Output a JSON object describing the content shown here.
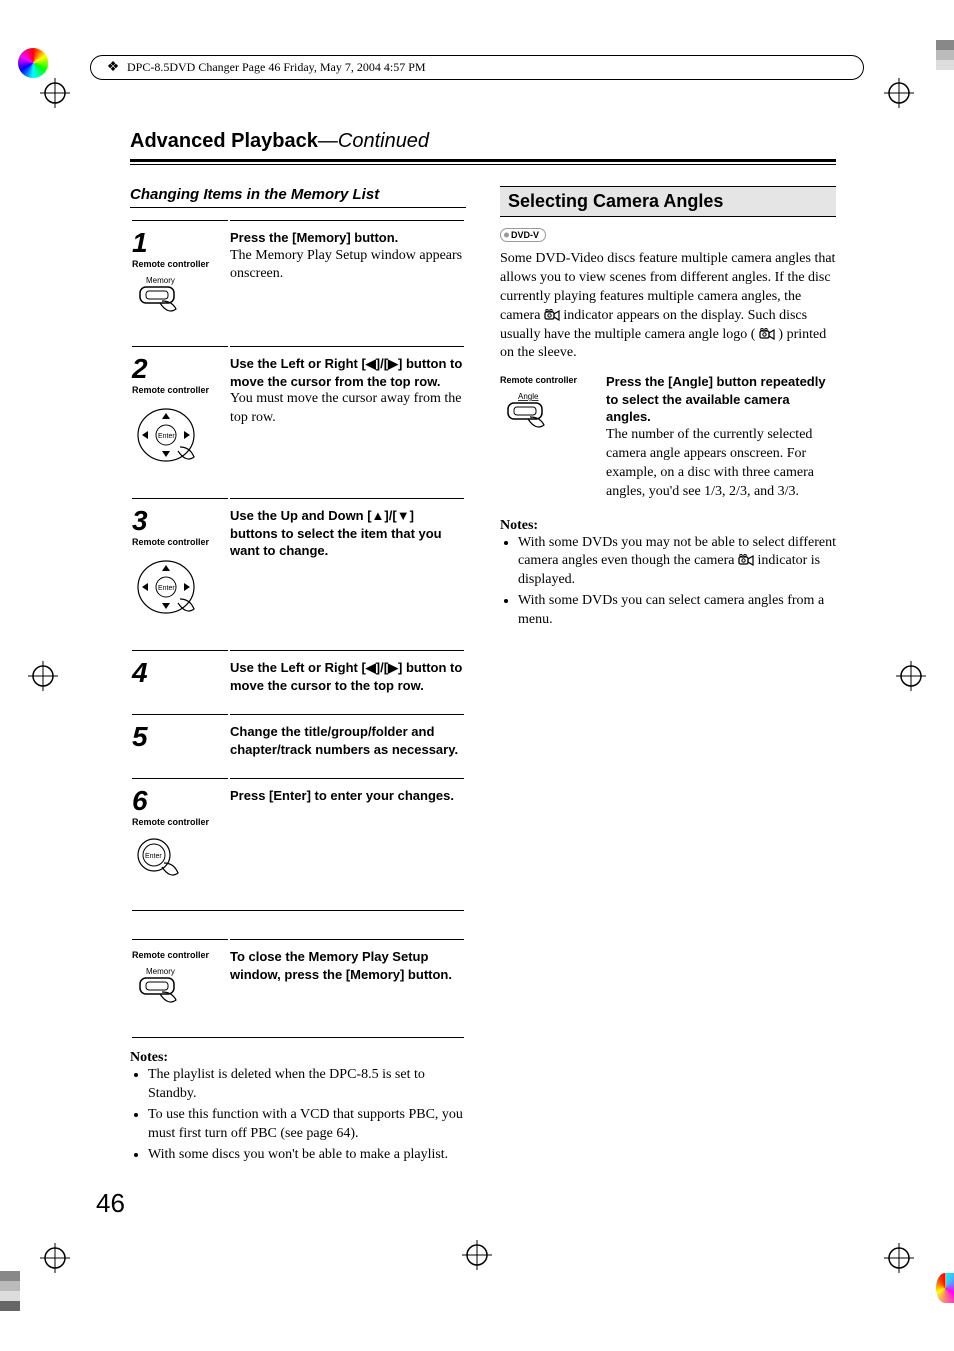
{
  "framemaker": {
    "text": "DPC-8.5DVD Changer  Page 46  Friday, May 7, 2004  4:57 PM"
  },
  "heading": {
    "main": "Advanced Playback",
    "cont": "—Continued"
  },
  "left": {
    "subheading": "Changing Items in the Memory List",
    "steps": [
      {
        "num": "1",
        "rc": "Remote controller",
        "btn_label": "Memory",
        "bold": "Press the [Memory] button.",
        "body": "The Memory Play Setup window appears onscreen."
      },
      {
        "num": "2",
        "rc": "Remote controller",
        "btn_label": "Enter",
        "bold": "Use the Left or Right [◀]/[▶] button to move the cursor from the top row.",
        "body": "You must move the cursor away from the top row."
      },
      {
        "num": "3",
        "rc": "Remote controller",
        "btn_label": "Enter",
        "bold": "Use the Up and Down [▲]/[▼] buttons to select the item that you want to change.",
        "body": ""
      },
      {
        "num": "4",
        "rc": "",
        "btn_label": "",
        "bold": "Use the Left or Right [◀]/[▶] button to move the cursor to the top row.",
        "body": ""
      },
      {
        "num": "5",
        "rc": "",
        "btn_label": "",
        "bold": "Change the title/group/folder and chapter/track numbers as necessary.",
        "body": ""
      },
      {
        "num": "6",
        "rc": "Remote controller",
        "btn_label": "Enter",
        "bold": "Press [Enter] to enter your changes.",
        "body": ""
      }
    ],
    "close": {
      "rc": "Remote controller",
      "btn_label": "Memory",
      "bold": "To close the Memory Play Setup window, press the [Memory] button."
    },
    "notes_label": "Notes:",
    "notes": [
      "The playlist is deleted when the DPC-8.5 is set to Standby.",
      "To use this function with a VCD that supports PBC, you must first turn off PBC (see page 64).",
      "With some discs you won't be able to make a playlist."
    ]
  },
  "right": {
    "section_title": "Selecting Camera Angles",
    "badge": "DVD-V",
    "para_parts": {
      "a": "Some DVD-Video discs feature multiple camera angles that allows you to view scenes from different angles. If the disc currently playing features multiple camera angles, the camera ",
      "b": " indicator appears on the display. Such discs usually have the multiple camera angle logo ( ",
      "c": " ) printed on the sleeve."
    },
    "angle": {
      "rc": "Remote controller",
      "btn_label": "Angle",
      "bold": "Press the [Angle] button repeatedly to select the available camera angles.",
      "body": "The number of the currently selected camera angle appears onscreen. For example, on a disc with three camera angles, you'd see 1/3, 2/3, and 3/3."
    },
    "notes_label": "Notes:",
    "note1_parts": {
      "a": "With some DVDs you may not be able to select different camera angles even though the camera ",
      "b": " indicator is displayed."
    },
    "note2": "With some DVDs you can select camera angles from a menu."
  },
  "page_number": "46"
}
